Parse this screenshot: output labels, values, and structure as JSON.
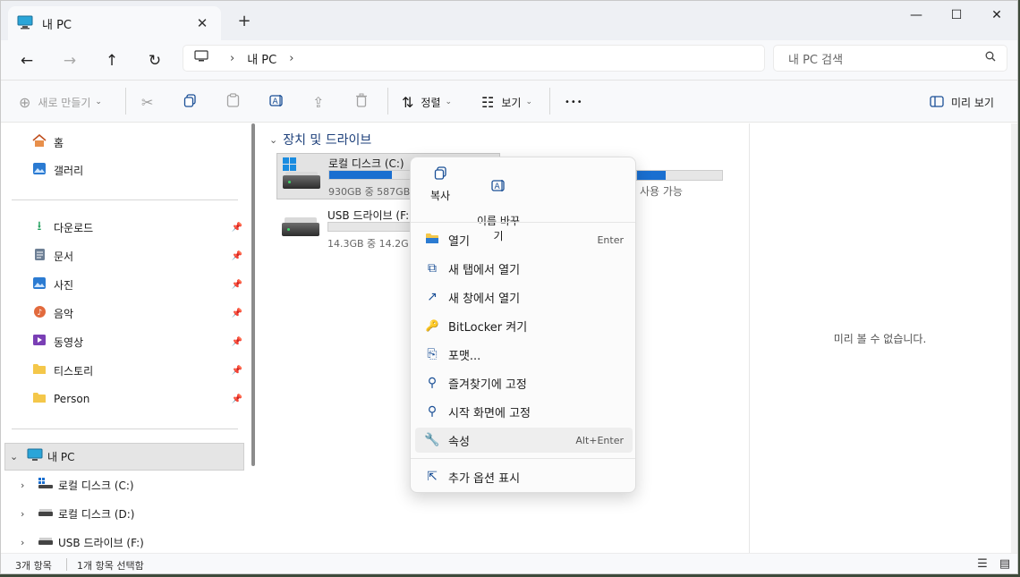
{
  "window": {
    "tab_title": "내 PC",
    "new_tab": "+",
    "controls": {
      "minimize": "—",
      "maximize": "☐",
      "close": "✕"
    }
  },
  "navigation": {
    "back": "←",
    "forward": "→",
    "up": "↑",
    "refresh": "↻",
    "breadcrumb": [
      "내 PC"
    ],
    "search_placeholder": "내 PC 검색"
  },
  "toolbar": {
    "new_label": "새로 만들기",
    "sort_label": "정렬",
    "view_label": "보기",
    "more_label": "•••",
    "preview_label": "미리 보기"
  },
  "sidebar": {
    "top": [
      {
        "label": "홈",
        "icon": "home-icon"
      },
      {
        "label": "갤러리",
        "icon": "gallery-icon"
      }
    ],
    "pinned": [
      {
        "label": "다운로드",
        "icon": "download-icon"
      },
      {
        "label": "문서",
        "icon": "document-icon"
      },
      {
        "label": "사진",
        "icon": "picture-icon"
      },
      {
        "label": "음악",
        "icon": "music-icon"
      },
      {
        "label": "동영상",
        "icon": "video-icon"
      },
      {
        "label": "티스토리",
        "icon": "folder-icon"
      },
      {
        "label": "Person",
        "icon": "folder-icon"
      }
    ],
    "this_pc": "내 PC",
    "drives": [
      {
        "label": "로컬 디스크 (C:)",
        "icon": "windows-drive-icon"
      },
      {
        "label": "로컬 디스크 (D:)",
        "icon": "drive-icon"
      },
      {
        "label": "USB 드라이브 (F:)",
        "icon": "usb-drive-icon"
      }
    ]
  },
  "main": {
    "group_title": "장치 및 드라이브",
    "drives": [
      {
        "name": "로컬 디스크 (C:)",
        "info": "930GB 중 587GB",
        "usage_fraction": 0.37
      },
      {
        "name": "USB 드라이브 (F:",
        "info": "14.3GB 중 14.2G",
        "usage_fraction": 0.0
      }
    ],
    "partial_drive": {
      "info": "사용 가능",
      "usage_fraction": 0.34
    }
  },
  "preview": {
    "empty_text": "미리 볼 수 없습니다."
  },
  "status": {
    "item_count": "3개 항목",
    "selected": "1개 항목 선택함"
  },
  "context_menu": {
    "quick_actions": [
      {
        "label": "복사",
        "icon": "copy-icon"
      },
      {
        "label": "이름 바꾸\n기",
        "icon": "rename-icon"
      }
    ],
    "items": [
      {
        "label": "열기",
        "shortcut": "Enter",
        "icon": "open-folder-icon"
      },
      {
        "label": "새 탭에서 열기",
        "shortcut": "",
        "icon": "new-tab-icon"
      },
      {
        "label": "새 창에서 열기",
        "shortcut": "",
        "icon": "new-window-icon"
      },
      {
        "label": "BitLocker 켜기",
        "shortcut": "",
        "icon": "bitlocker-icon"
      },
      {
        "label": "포맷...",
        "shortcut": "",
        "icon": "format-icon"
      },
      {
        "label": "즐겨찾기에 고정",
        "shortcut": "",
        "icon": "pin-icon"
      },
      {
        "label": "시작 화면에 고정",
        "shortcut": "",
        "icon": "pin-icon"
      },
      {
        "label": "속성",
        "shortcut": "Alt+Enter",
        "icon": "wrench-icon"
      }
    ],
    "more": {
      "label": "추가 옵션 표시",
      "icon": "share-out-icon"
    }
  }
}
